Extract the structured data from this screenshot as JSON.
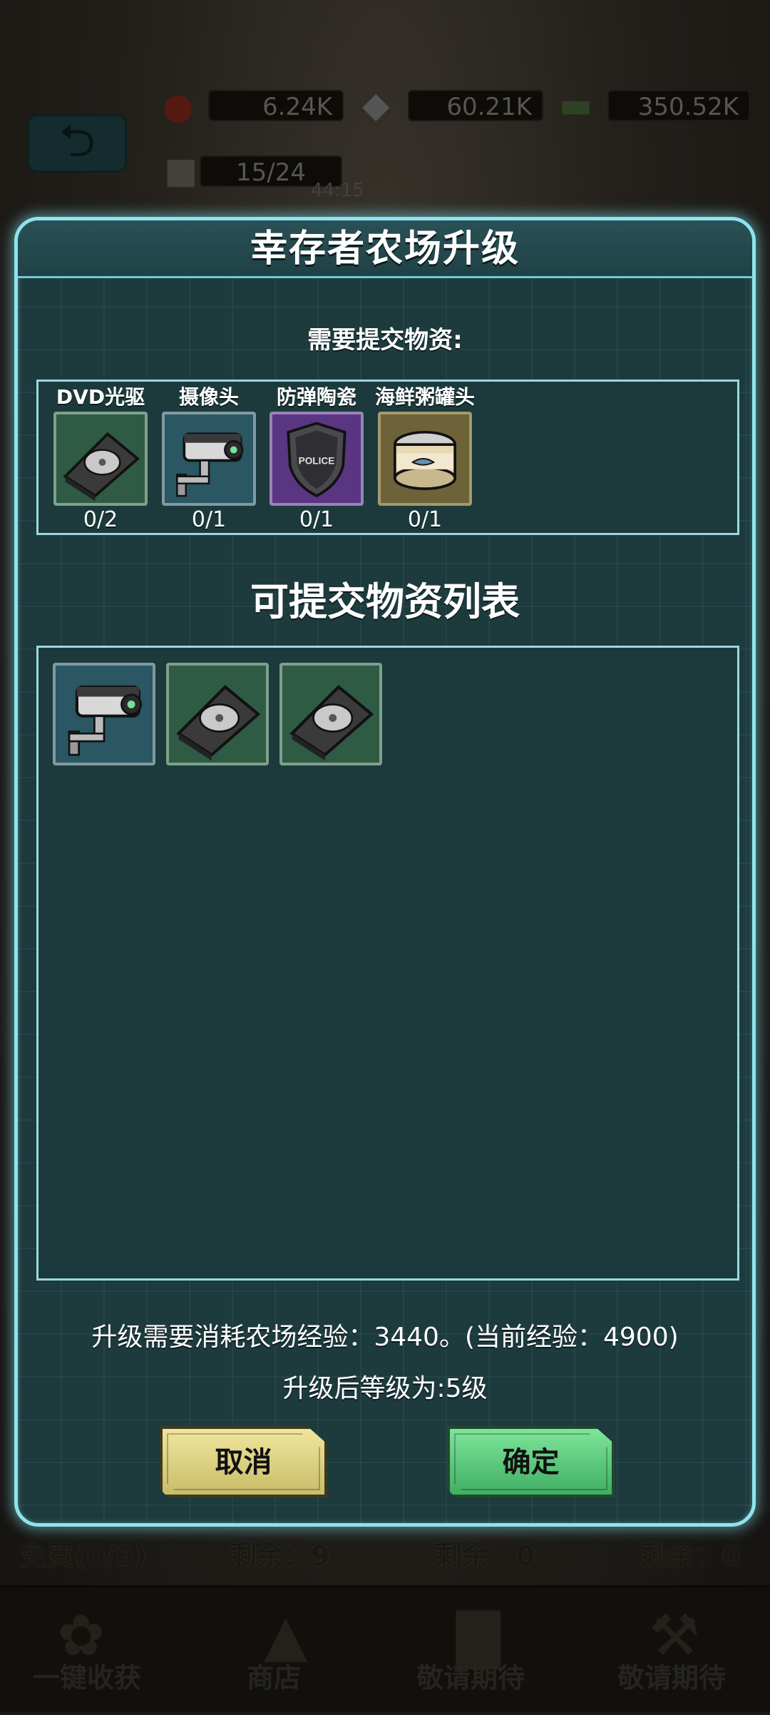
{
  "background": {
    "hud": {
      "food": "6.24K",
      "diamonds": "60.21K",
      "cash": "350.52K",
      "survivors": "15/24",
      "timer": "44:15"
    },
    "bottom_labels": [
      "免费(0/6)",
      "剩余：9",
      "剩余：0",
      "剩余：0"
    ],
    "nav": [
      "一键收获",
      "商店",
      "敬请期待",
      "敬请期待"
    ]
  },
  "dialog": {
    "title": "幸存者农场升级",
    "required_label": "需要提交物资:",
    "required_items": [
      {
        "name": "DVD光驱",
        "count": "0/2",
        "icon": "dvd-drive-icon",
        "rarity": "green"
      },
      {
        "name": "摄像头",
        "count": "0/1",
        "icon": "camera-icon",
        "rarity": "blue"
      },
      {
        "name": "防弹陶瓷",
        "count": "0/1",
        "icon": "police-shield-icon",
        "rarity": "purple"
      },
      {
        "name": "海鲜粥罐头",
        "count": "0/1",
        "icon": "canned-food-icon",
        "rarity": "khaki"
      }
    ],
    "available_title": "可提交物资列表",
    "available_items": [
      {
        "icon": "camera-icon",
        "rarity": "blue"
      },
      {
        "icon": "dvd-drive-icon",
        "rarity": "green"
      },
      {
        "icon": "dvd-drive-icon",
        "rarity": "green"
      }
    ],
    "info_line1": "升级需要消耗农场经验：3440。(当前经验：4900)",
    "info_line2": "升级后等级为:5级",
    "cancel_label": "取消",
    "confirm_label": "确定"
  }
}
